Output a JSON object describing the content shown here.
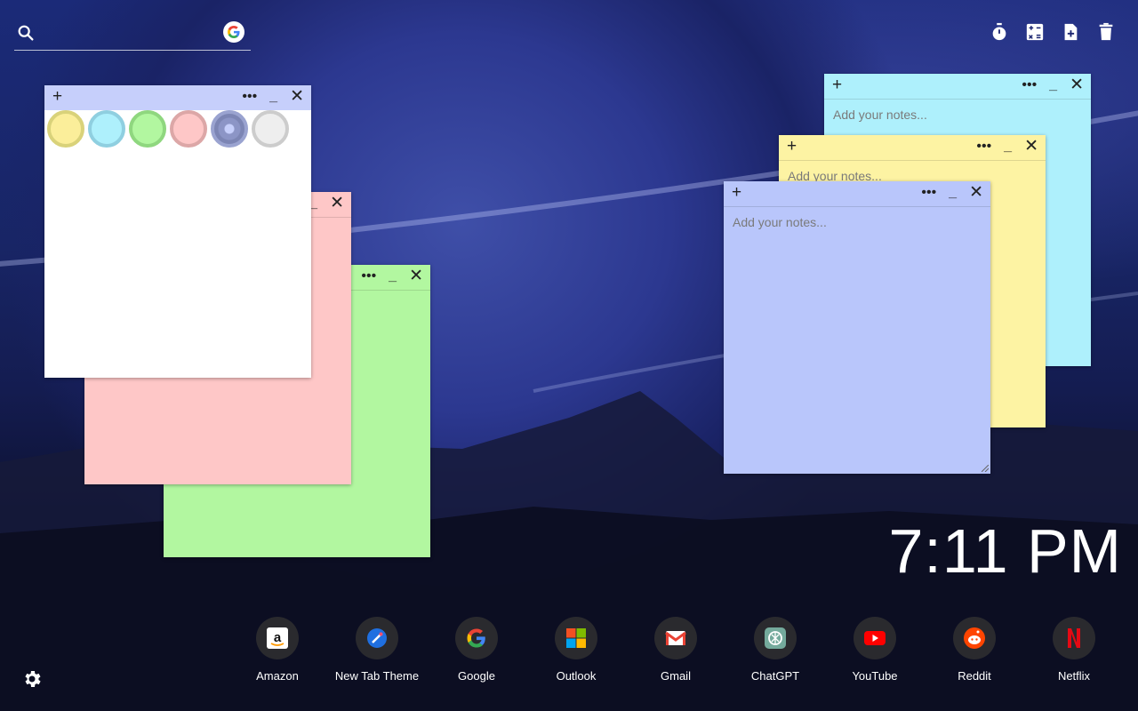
{
  "search": {
    "placeholder": "",
    "icon": "search-icon",
    "engine_icon": "google-icon"
  },
  "tools": [
    "timer-icon",
    "calculator-icon",
    "add-note-icon",
    "trash-icon"
  ],
  "notes": [
    {
      "color": "#b2f7a0",
      "placeholder": ""
    },
    {
      "color": "#fec7c7",
      "placeholder": ""
    },
    {
      "color": "#ffffff",
      "header_color": "#c6cffb",
      "placeholder": ""
    },
    {
      "color": "#aef0fc",
      "placeholder": "Add your notes..."
    },
    {
      "color": "#fdf3a3",
      "placeholder": "Add your notes..."
    },
    {
      "color": "#b9c6fb",
      "placeholder": "Add your notes..."
    }
  ],
  "note_controls": {
    "add": "+",
    "more": "•••",
    "minimize": "_",
    "close": "✕"
  },
  "palette": [
    {
      "name": "yellow",
      "fill": "#fbee9a",
      "ring": "#d9d27a"
    },
    {
      "name": "cyan",
      "fill": "#aef0fc",
      "ring": "#8fcfe0"
    },
    {
      "name": "green",
      "fill": "#b2f7a0",
      "ring": "#8fd77f"
    },
    {
      "name": "pink",
      "fill": "#fec7c7",
      "ring": "#dca7a7"
    },
    {
      "name": "blue",
      "fill": "#c6cffb",
      "ring": "#7c85b4",
      "selected": true
    },
    {
      "name": "white",
      "fill": "#eeeeee",
      "ring": "#cccccc"
    }
  ],
  "clock": {
    "time": "7:11 PM"
  },
  "dock": [
    {
      "label": "Amazon",
      "icon": "amazon-icon"
    },
    {
      "label": "New Tab Theme",
      "icon": "new-tab-theme-icon"
    },
    {
      "label": "Google",
      "icon": "google-icon"
    },
    {
      "label": "Outlook",
      "icon": "outlook-icon"
    },
    {
      "label": "Gmail",
      "icon": "gmail-icon"
    },
    {
      "label": "ChatGPT",
      "icon": "chatgpt-icon"
    },
    {
      "label": "YouTube",
      "icon": "youtube-icon"
    },
    {
      "label": "Reddit",
      "icon": "reddit-icon"
    },
    {
      "label": "Netflix",
      "icon": "netflix-icon"
    }
  ],
  "settings_icon": "gear-icon"
}
